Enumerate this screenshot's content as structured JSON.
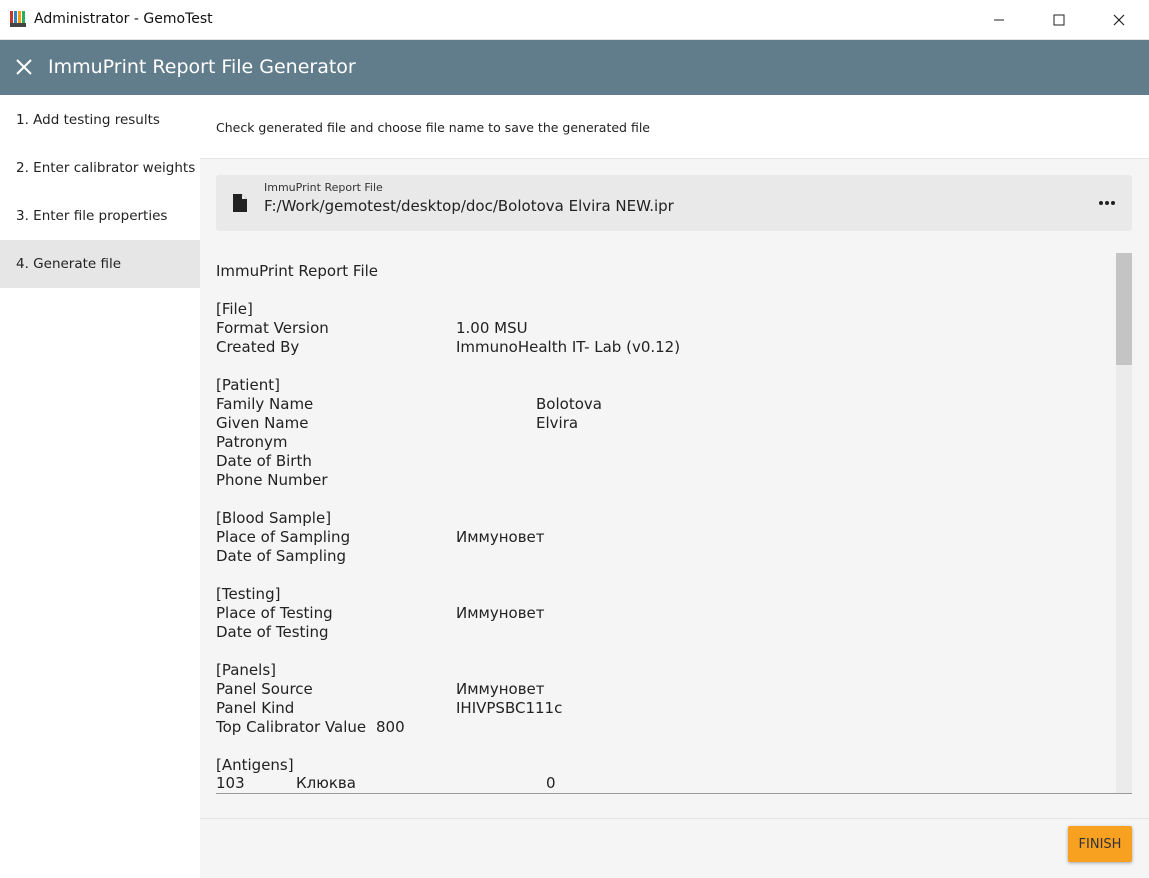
{
  "window": {
    "title": "Administrator - GemoTest"
  },
  "appbar": {
    "title": "ImmuPrint Report File Generator"
  },
  "steps": [
    {
      "label": "1. Add testing results"
    },
    {
      "label": "2. Enter calibrator weights"
    },
    {
      "label": "3. Enter file properties"
    },
    {
      "label": "4. Generate file"
    }
  ],
  "main": {
    "instruction": "Check generated file and choose file name to save the generated file",
    "file": {
      "label": "ImmuPrint Report File",
      "path": "F:/Work/gemotest/desktop/doc/Bolotova Elvira NEW.ipr"
    },
    "finish_label": "FINISH"
  },
  "preview": {
    "header": "ImmuPrint Report File",
    "file_section": "[File]",
    "format_version_key": "Format Version",
    "format_version_val": "1.00 MSU",
    "created_by_key": "Created By",
    "created_by_val": "ImmunoHealth IT-  Lab (v0.12)",
    "patient_section": "[Patient]",
    "family_name_key": "Family Name",
    "family_name_val": "Bolotova",
    "given_name_key": "Given Name",
    "given_name_val": "Elvira",
    "patronym_key": "Patronym",
    "dob_key": "Date of Birth",
    "phone_key": "Phone Number",
    "blood_section": "[Blood Sample]",
    "place_sampling_key": "Place of Sampling",
    "place_sampling_val": "Иммуновет",
    "date_sampling_key": "Date of Sampling",
    "testing_section": "[Testing]",
    "place_testing_key": "Place of Testing",
    "place_testing_val": "Иммуновет",
    "date_testing_key": "Date of Testing",
    "panels_section": "[Panels]",
    "panel_source_key": "Panel Source",
    "panel_source_val": "Иммуновет",
    "panel_kind_key": "Panel Kind",
    "panel_kind_val": "IHIVPSBC111c",
    "top_cal_key": "Top Calibrator Value",
    "top_cal_val": "800",
    "antigens_section": "[Antigens]",
    "antigen_id": "103",
    "antigen_name": "Клюква",
    "antigen_val": "0"
  }
}
